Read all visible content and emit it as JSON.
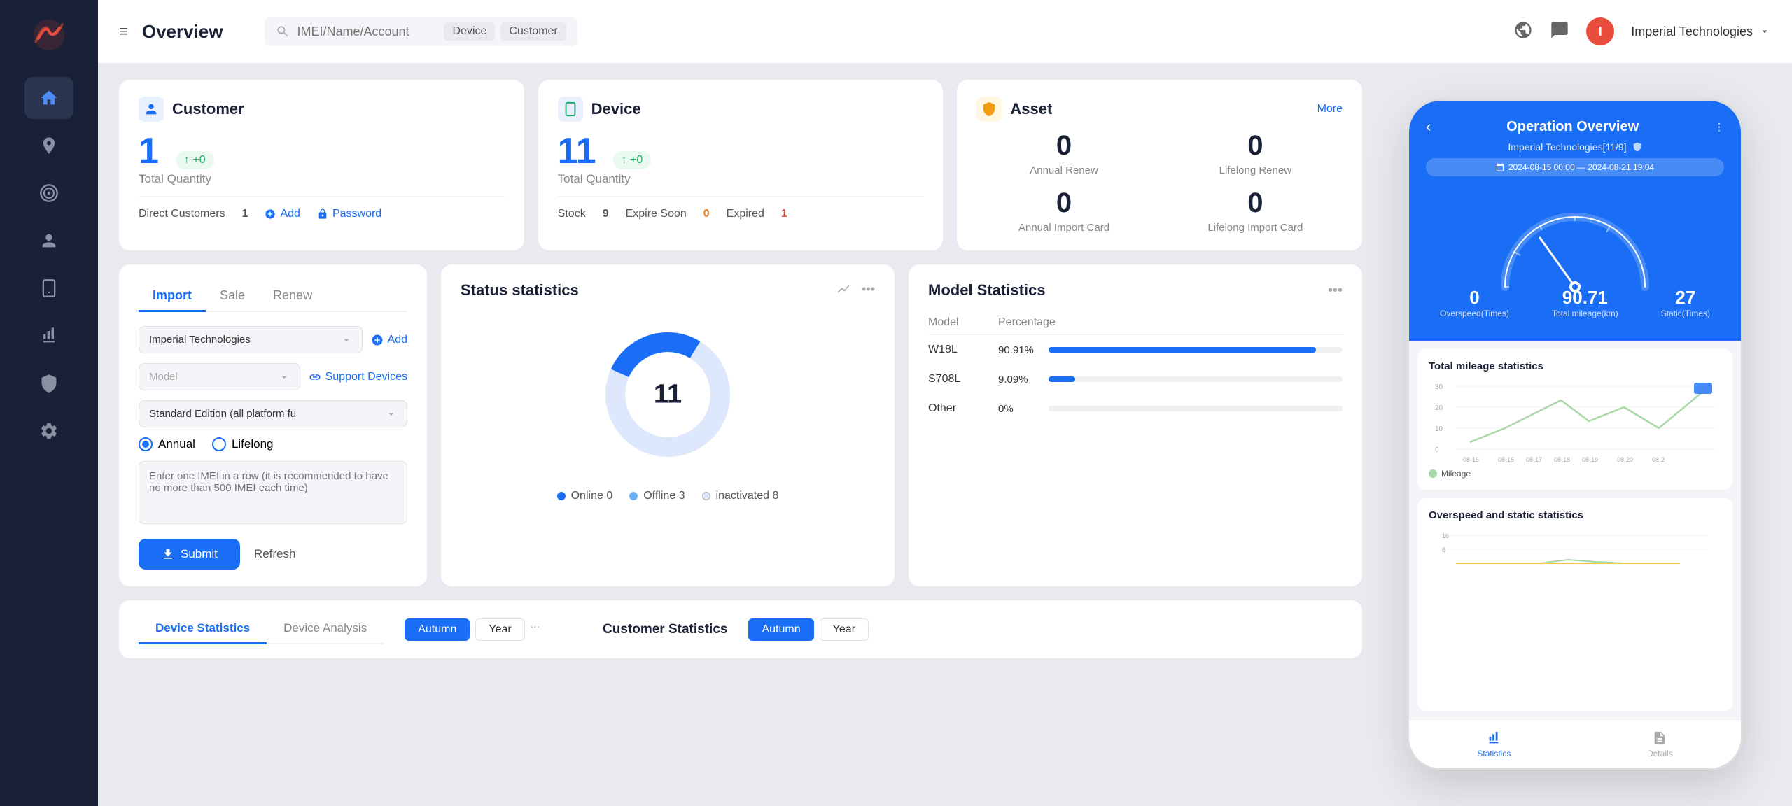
{
  "sidebar": {
    "logo_alt": "Logo",
    "items": [
      {
        "id": "home",
        "icon": "home-icon",
        "active": true
      },
      {
        "id": "location",
        "icon": "location-icon",
        "active": false
      },
      {
        "id": "target",
        "icon": "target-icon",
        "active": false
      },
      {
        "id": "user",
        "icon": "user-icon",
        "active": false
      },
      {
        "id": "device",
        "icon": "device-icon",
        "active": false
      },
      {
        "id": "chart",
        "icon": "chart-icon",
        "active": false
      },
      {
        "id": "shield",
        "icon": "shield-icon",
        "active": false
      },
      {
        "id": "settings",
        "icon": "settings-icon",
        "active": false
      }
    ]
  },
  "topbar": {
    "menu_icon": "≡",
    "title": "Overview",
    "search_placeholder": "IMEI/Name/Account",
    "search_tags": [
      "Device",
      "Customer"
    ],
    "user_name": "Imperial Technologies",
    "avatar_text": "I"
  },
  "customer_card": {
    "title": "Customer",
    "total_quantity": "1",
    "badge": "↑ +0",
    "total_label": "Total Quantity",
    "direct_customers_label": "Direct Customers",
    "direct_customers_value": "1",
    "add_label": "Add",
    "password_label": "Password"
  },
  "device_card": {
    "title": "Device",
    "total_quantity": "11",
    "badge": "↑ +0",
    "total_label": "Total Quantity",
    "stock_label": "Stock",
    "stock_value": "9",
    "expire_soon_label": "Expire Soon",
    "expire_soon_value": "0",
    "expired_label": "Expired",
    "expired_value": "1"
  },
  "asset_card": {
    "title": "Asset",
    "more_label": "More",
    "annual_renew_label": "Annual Renew",
    "annual_renew_value": "0",
    "lifelong_renew_label": "Lifelong Renew",
    "lifelong_renew_value": "0",
    "annual_import_label": "Annual Import Card",
    "annual_import_value": "0",
    "lifelong_import_label": "Lifelong Import Card",
    "lifelong_import_value": "0"
  },
  "import_section": {
    "tabs": [
      "Import",
      "Sale",
      "Renew"
    ],
    "active_tab": "Import",
    "company_value": "Imperial Technologies",
    "model_placeholder": "Model",
    "edition_value": "Standard Edition (all platform fu",
    "add_label": "Add",
    "support_label": "Support Devices",
    "radio_annual": "Annual",
    "radio_lifelong": "Lifelong",
    "textarea_placeholder": "Enter one IMEI in a row (it is recommended to have no more than 500 IMEI each time)",
    "submit_label": "Submit",
    "refresh_label": "Refresh"
  },
  "status_stats": {
    "title": "Status statistics",
    "total": "11",
    "online_label": "Online",
    "online_value": "0",
    "offline_label": "Offline",
    "offline_value": "3",
    "inactivated_label": "inactivated",
    "inactivated_value": "8",
    "donut": {
      "online_pct": 0,
      "offline_pct": 27,
      "inactive_pct": 73,
      "colors": [
        "#1a6ef5",
        "#6ab0f5",
        "#dde8fc"
      ]
    }
  },
  "model_stats": {
    "title": "Model Statistics",
    "col_model": "Model",
    "col_percentage": "Percentage",
    "rows": [
      {
        "model": "W18L",
        "pct_label": "90.91%",
        "pct_val": 90.91
      },
      {
        "model": "S708L",
        "pct_label": "9.09%",
        "pct_val": 9.09
      },
      {
        "model": "Other",
        "pct_label": "0%",
        "pct_val": 0
      }
    ]
  },
  "bottom_section": {
    "device_stats_label": "Device Statistics",
    "device_analysis_label": "Device Analysis",
    "active_tab": "Device Statistics",
    "time_buttons": [
      "Autumn",
      "Year"
    ],
    "active_time": "Autumn",
    "more_icon": "...",
    "customer_stats_label": "Customer Statistics",
    "customer_time_buttons": [
      "Autumn",
      "Year"
    ],
    "customer_active_time": "Autumn"
  },
  "phone_mockup": {
    "title": "Operation Overview",
    "subtitle": "Imperial Technologies[11/9]",
    "date_range": "2024-08-15 00:00 — 2024-08-21 19:04",
    "overspeed_label": "Overspeed(Times)",
    "overspeed_value": "0",
    "mileage_label": "Total mileage(km)",
    "mileage_value": "90.71",
    "static_label": "Static(Times)",
    "static_value": "27",
    "total_mileage_title": "Total mileage statistics",
    "y_labels": [
      "30",
      "20",
      "10",
      "0"
    ],
    "x_labels": [
      "08-15",
      "08-16",
      "08-17",
      "08-18",
      "08-19",
      "08-20",
      "08-2"
    ],
    "mileage_legend": "Mileage",
    "overspeed_static_title": "Overspeed and static statistics",
    "footer_tabs": [
      {
        "label": "Statistics",
        "active": true
      },
      {
        "label": "Details",
        "active": false
      }
    ]
  }
}
